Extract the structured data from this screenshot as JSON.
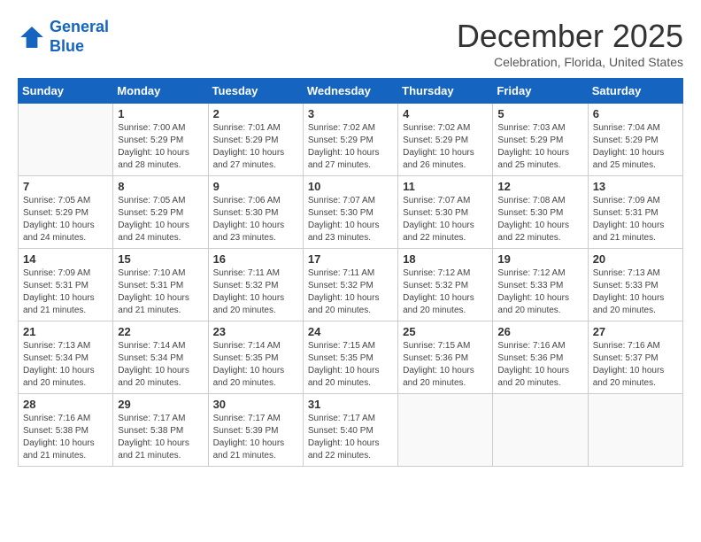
{
  "logo": {
    "line1": "General",
    "line2": "Blue"
  },
  "calendar": {
    "title": "December 2025",
    "subtitle": "Celebration, Florida, United States",
    "days_of_week": [
      "Sunday",
      "Monday",
      "Tuesday",
      "Wednesday",
      "Thursday",
      "Friday",
      "Saturday"
    ],
    "weeks": [
      [
        {
          "num": "",
          "info": ""
        },
        {
          "num": "1",
          "info": "Sunrise: 7:00 AM\nSunset: 5:29 PM\nDaylight: 10 hours\nand 28 minutes."
        },
        {
          "num": "2",
          "info": "Sunrise: 7:01 AM\nSunset: 5:29 PM\nDaylight: 10 hours\nand 27 minutes."
        },
        {
          "num": "3",
          "info": "Sunrise: 7:02 AM\nSunset: 5:29 PM\nDaylight: 10 hours\nand 27 minutes."
        },
        {
          "num": "4",
          "info": "Sunrise: 7:02 AM\nSunset: 5:29 PM\nDaylight: 10 hours\nand 26 minutes."
        },
        {
          "num": "5",
          "info": "Sunrise: 7:03 AM\nSunset: 5:29 PM\nDaylight: 10 hours\nand 25 minutes."
        },
        {
          "num": "6",
          "info": "Sunrise: 7:04 AM\nSunset: 5:29 PM\nDaylight: 10 hours\nand 25 minutes."
        }
      ],
      [
        {
          "num": "7",
          "info": "Sunrise: 7:05 AM\nSunset: 5:29 PM\nDaylight: 10 hours\nand 24 minutes."
        },
        {
          "num": "8",
          "info": "Sunrise: 7:05 AM\nSunset: 5:29 PM\nDaylight: 10 hours\nand 24 minutes."
        },
        {
          "num": "9",
          "info": "Sunrise: 7:06 AM\nSunset: 5:30 PM\nDaylight: 10 hours\nand 23 minutes."
        },
        {
          "num": "10",
          "info": "Sunrise: 7:07 AM\nSunset: 5:30 PM\nDaylight: 10 hours\nand 23 minutes."
        },
        {
          "num": "11",
          "info": "Sunrise: 7:07 AM\nSunset: 5:30 PM\nDaylight: 10 hours\nand 22 minutes."
        },
        {
          "num": "12",
          "info": "Sunrise: 7:08 AM\nSunset: 5:30 PM\nDaylight: 10 hours\nand 22 minutes."
        },
        {
          "num": "13",
          "info": "Sunrise: 7:09 AM\nSunset: 5:31 PM\nDaylight: 10 hours\nand 21 minutes."
        }
      ],
      [
        {
          "num": "14",
          "info": "Sunrise: 7:09 AM\nSunset: 5:31 PM\nDaylight: 10 hours\nand 21 minutes."
        },
        {
          "num": "15",
          "info": "Sunrise: 7:10 AM\nSunset: 5:31 PM\nDaylight: 10 hours\nand 21 minutes."
        },
        {
          "num": "16",
          "info": "Sunrise: 7:11 AM\nSunset: 5:32 PM\nDaylight: 10 hours\nand 20 minutes."
        },
        {
          "num": "17",
          "info": "Sunrise: 7:11 AM\nSunset: 5:32 PM\nDaylight: 10 hours\nand 20 minutes."
        },
        {
          "num": "18",
          "info": "Sunrise: 7:12 AM\nSunset: 5:32 PM\nDaylight: 10 hours\nand 20 minutes."
        },
        {
          "num": "19",
          "info": "Sunrise: 7:12 AM\nSunset: 5:33 PM\nDaylight: 10 hours\nand 20 minutes."
        },
        {
          "num": "20",
          "info": "Sunrise: 7:13 AM\nSunset: 5:33 PM\nDaylight: 10 hours\nand 20 minutes."
        }
      ],
      [
        {
          "num": "21",
          "info": "Sunrise: 7:13 AM\nSunset: 5:34 PM\nDaylight: 10 hours\nand 20 minutes."
        },
        {
          "num": "22",
          "info": "Sunrise: 7:14 AM\nSunset: 5:34 PM\nDaylight: 10 hours\nand 20 minutes."
        },
        {
          "num": "23",
          "info": "Sunrise: 7:14 AM\nSunset: 5:35 PM\nDaylight: 10 hours\nand 20 minutes."
        },
        {
          "num": "24",
          "info": "Sunrise: 7:15 AM\nSunset: 5:35 PM\nDaylight: 10 hours\nand 20 minutes."
        },
        {
          "num": "25",
          "info": "Sunrise: 7:15 AM\nSunset: 5:36 PM\nDaylight: 10 hours\nand 20 minutes."
        },
        {
          "num": "26",
          "info": "Sunrise: 7:16 AM\nSunset: 5:36 PM\nDaylight: 10 hours\nand 20 minutes."
        },
        {
          "num": "27",
          "info": "Sunrise: 7:16 AM\nSunset: 5:37 PM\nDaylight: 10 hours\nand 20 minutes."
        }
      ],
      [
        {
          "num": "28",
          "info": "Sunrise: 7:16 AM\nSunset: 5:38 PM\nDaylight: 10 hours\nand 21 minutes."
        },
        {
          "num": "29",
          "info": "Sunrise: 7:17 AM\nSunset: 5:38 PM\nDaylight: 10 hours\nand 21 minutes."
        },
        {
          "num": "30",
          "info": "Sunrise: 7:17 AM\nSunset: 5:39 PM\nDaylight: 10 hours\nand 21 minutes."
        },
        {
          "num": "31",
          "info": "Sunrise: 7:17 AM\nSunset: 5:40 PM\nDaylight: 10 hours\nand 22 minutes."
        },
        {
          "num": "",
          "info": ""
        },
        {
          "num": "",
          "info": ""
        },
        {
          "num": "",
          "info": ""
        }
      ]
    ]
  }
}
